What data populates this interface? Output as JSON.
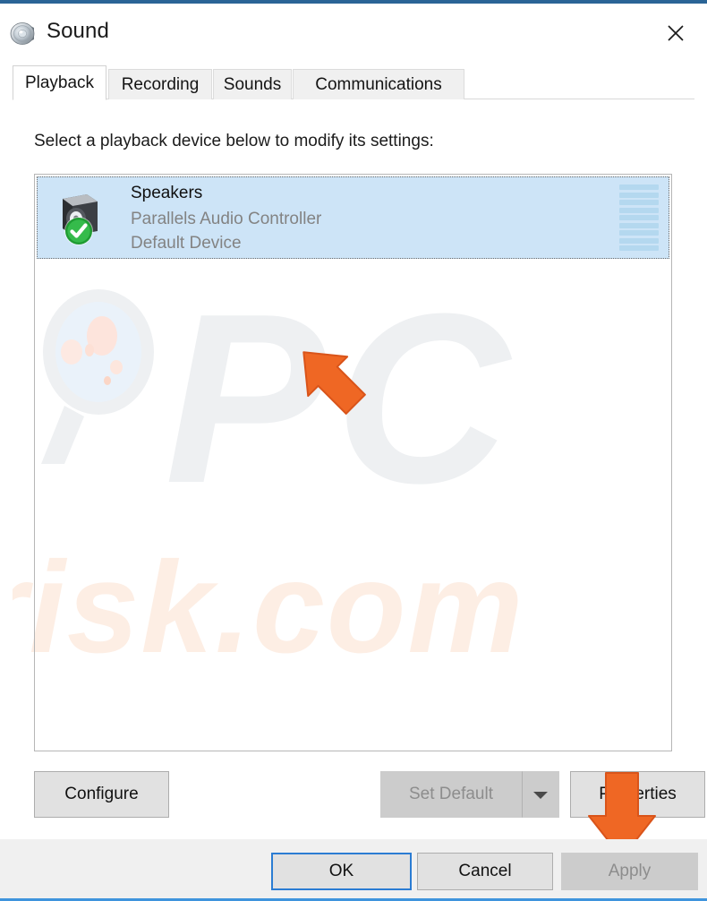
{
  "window": {
    "title": "Sound",
    "icon": "speaker-icon",
    "close_label": "Close",
    "accent_color": "#2a6496",
    "bottom_accent_color": "#3f94dd"
  },
  "tabs": [
    {
      "label": "Playback",
      "active": true
    },
    {
      "label": "Recording",
      "active": false
    },
    {
      "label": "Sounds",
      "active": false
    },
    {
      "label": "Communications",
      "active": false
    }
  ],
  "main": {
    "instruction": "Select a playback device below to modify its settings:",
    "devices": [
      {
        "name": "Speakers",
        "driver": "Parallels Audio Controller",
        "status": "Default Device",
        "selected": true,
        "default_badge": "green-check-icon",
        "meter_segments": 9,
        "meter_level": 0
      }
    ]
  },
  "actions": {
    "configure": {
      "label": "Configure",
      "enabled": true
    },
    "set_default": {
      "label": "Set Default",
      "enabled": false,
      "has_dropdown": true
    },
    "properties": {
      "label": "Properties",
      "enabled": true
    }
  },
  "footer": {
    "ok": {
      "label": "OK",
      "enabled": true,
      "is_default": true
    },
    "cancel": {
      "label": "Cancel",
      "enabled": true
    },
    "apply": {
      "label": "Apply",
      "enabled": false
    }
  },
  "watermark": {
    "primary": "PC",
    "secondary": "risk.com",
    "logo": "magnifier-icon"
  },
  "annotations": [
    {
      "name": "arrow-pointing-at-speakers-device",
      "direction": "up-left",
      "color": "#ef6724"
    },
    {
      "name": "arrow-pointing-at-properties-button",
      "direction": "down",
      "color": "#ef6724"
    }
  ]
}
